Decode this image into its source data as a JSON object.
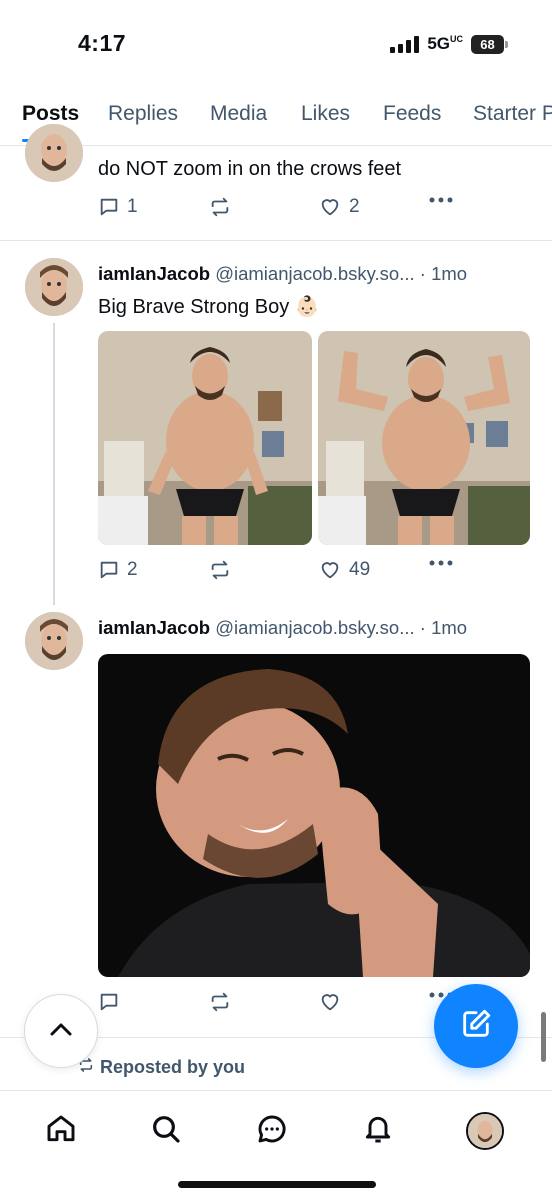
{
  "status": {
    "time": "4:17",
    "network": "5G",
    "network_suffix": "UC",
    "battery": "68"
  },
  "tabs": [
    {
      "label": "Posts",
      "active": true
    },
    {
      "label": "Replies",
      "active": false
    },
    {
      "label": "Media",
      "active": false
    },
    {
      "label": "Likes",
      "active": false
    },
    {
      "label": "Feeds",
      "active": false
    },
    {
      "label": "Starter Packs",
      "active": false
    }
  ],
  "posts": [
    {
      "text": "do NOT zoom in on the crows feet",
      "replies": "1",
      "likes": "2"
    },
    {
      "display_name": "iamIanJacob",
      "handle": "@iamianjacob.bsky.so...",
      "time": "· 1mo",
      "text": "Big Brave Strong Boy 👶🏻",
      "replies": "2",
      "likes": "49"
    },
    {
      "display_name": "iamIanJacob",
      "handle": "@iamianjacob.bsky.so...",
      "time": "· 1mo",
      "replies": "",
      "likes": ""
    }
  ],
  "repost_label": "Reposted by you",
  "icons": {
    "reply": "reply-icon",
    "repost": "repost-icon",
    "like": "heart-icon",
    "more": "more-dots-icon",
    "compose": "compose-icon",
    "scroll_top": "chevron-up-icon",
    "nav": [
      "home-icon",
      "search-icon",
      "chat-icon",
      "bell-icon",
      "profile-avatar"
    ]
  },
  "colors": {
    "accent": "#1083fe",
    "muted": "#42576c",
    "divider": "#e3e7ec"
  }
}
